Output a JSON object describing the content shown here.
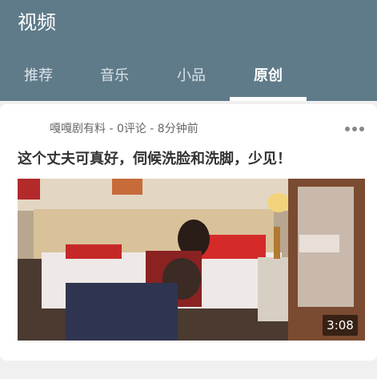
{
  "app": {
    "title": "视频"
  },
  "tabs": [
    {
      "label": "推荐",
      "active": false
    },
    {
      "label": "音乐",
      "active": false
    },
    {
      "label": "小品",
      "active": false
    },
    {
      "label": "原创",
      "active": true
    }
  ],
  "feed": {
    "items": [
      {
        "author": "嘎嘎剧有料",
        "comments": "0评论",
        "time": "8分钟前",
        "meta_line": "嘎嘎剧有料 - 0评论 - 8分钟前",
        "title": "这个丈夫可真好，伺候洗脸和洗脚，少见！",
        "duration": "3:08",
        "thumbnail_icon": "video-thumbnail"
      }
    ]
  },
  "colors": {
    "header_bg": "#5f7b8a",
    "tab_inactive": "#dbe3e7",
    "tab_active": "#ffffff",
    "card_bg": "#ffffff",
    "page_bg": "#f0f0f0"
  },
  "icons": {
    "more": "more-dots-icon"
  }
}
